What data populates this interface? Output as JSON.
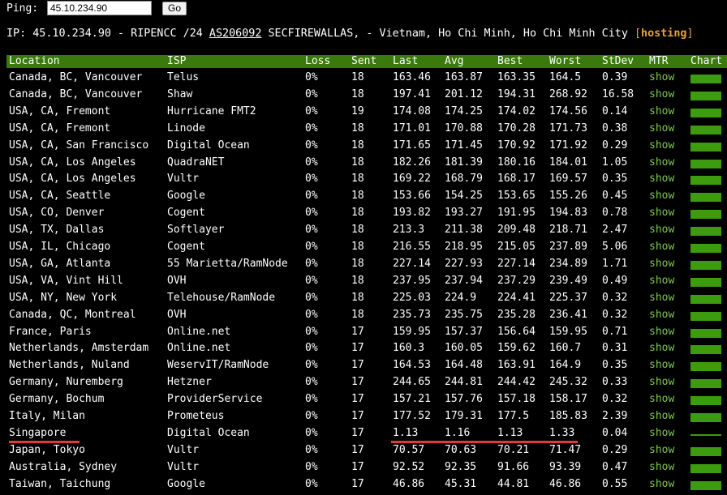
{
  "ping": {
    "label": "Ping:",
    "value": "45.10.234.90",
    "go": "Go"
  },
  "info": {
    "prefix": "IP: 45.10.234.90 - RIPENCC /24 ",
    "asn": "AS206092",
    "rest": " SECFIREWALLAS, - Vietnam, Ho Chi Minh, Ho Chi Minh City ",
    "open": "[",
    "tag": "hosting",
    "close": "]"
  },
  "columns": [
    "Location",
    "ISP",
    "Loss",
    "Sent",
    "Last",
    "Avg",
    "Best",
    "Worst",
    "StDev",
    "MTR",
    "Chart"
  ],
  "colors": {
    "header_bg": "#3a7a0c",
    "link": "#7ec850",
    "bar": "#3d9b10",
    "accent": "#e8a040",
    "underline": "#e03a35"
  },
  "rows": [
    {
      "loc": "Canada, BC, Vancouver",
      "isp": "Telus",
      "loss": "0%",
      "sent": "18",
      "last": "163.46",
      "avg": "163.87",
      "best": "163.35",
      "worst": "164.5",
      "std": "0.39",
      "mtr": "show"
    },
    {
      "loc": "Canada, BC, Vancouver",
      "isp": "Shaw",
      "loss": "0%",
      "sent": "18",
      "last": "197.41",
      "avg": "201.12",
      "best": "194.31",
      "worst": "268.92",
      "std": "16.58",
      "mtr": "show"
    },
    {
      "loc": "USA, CA, Fremont",
      "isp": "Hurricane FMT2",
      "loss": "0%",
      "sent": "19",
      "last": "174.08",
      "avg": "174.25",
      "best": "174.02",
      "worst": "174.56",
      "std": "0.14",
      "mtr": "show"
    },
    {
      "loc": "USA, CA, Fremont",
      "isp": "Linode",
      "loss": "0%",
      "sent": "18",
      "last": "171.01",
      "avg": "170.88",
      "best": "170.28",
      "worst": "171.73",
      "std": "0.38",
      "mtr": "show"
    },
    {
      "loc": "USA, CA, San Francisco",
      "isp": "Digital Ocean",
      "loss": "0%",
      "sent": "18",
      "last": "171.65",
      "avg": "171.45",
      "best": "170.92",
      "worst": "171.92",
      "std": "0.29",
      "mtr": "show"
    },
    {
      "loc": "USA, CA, Los Angeles",
      "isp": "QuadraNET",
      "loss": "0%",
      "sent": "18",
      "last": "182.26",
      "avg": "181.39",
      "best": "180.16",
      "worst": "184.01",
      "std": "1.05",
      "mtr": "show"
    },
    {
      "loc": "USA, CA, Los Angeles",
      "isp": "Vultr",
      "loss": "0%",
      "sent": "18",
      "last": "169.22",
      "avg": "168.79",
      "best": "168.17",
      "worst": "169.57",
      "std": "0.35",
      "mtr": "show"
    },
    {
      "loc": "USA, CA, Seattle",
      "isp": "Google",
      "loss": "0%",
      "sent": "18",
      "last": "153.66",
      "avg": "154.25",
      "best": "153.65",
      "worst": "155.26",
      "std": "0.45",
      "mtr": "show"
    },
    {
      "loc": "USA, CO, Denver",
      "isp": "Cogent",
      "loss": "0%",
      "sent": "18",
      "last": "193.82",
      "avg": "193.27",
      "best": "191.95",
      "worst": "194.83",
      "std": "0.78",
      "mtr": "show"
    },
    {
      "loc": "USA, TX, Dallas",
      "isp": "Softlayer",
      "loss": "0%",
      "sent": "18",
      "last": "213.3",
      "avg": "211.38",
      "best": "209.48",
      "worst": "218.71",
      "std": "2.47",
      "mtr": "show"
    },
    {
      "loc": "USA, IL, Chicago",
      "isp": "Cogent",
      "loss": "0%",
      "sent": "18",
      "last": "216.55",
      "avg": "218.95",
      "best": "215.05",
      "worst": "237.89",
      "std": "5.06",
      "mtr": "show"
    },
    {
      "loc": "USA, GA, Atlanta",
      "isp": "55 Marietta/RamNode",
      "loss": "0%",
      "sent": "18",
      "last": "227.14",
      "avg": "227.93",
      "best": "227.14",
      "worst": "234.89",
      "std": "1.71",
      "mtr": "show"
    },
    {
      "loc": "USA, VA, Vint Hill",
      "isp": "OVH",
      "loss": "0%",
      "sent": "18",
      "last": "237.95",
      "avg": "237.94",
      "best": "237.29",
      "worst": "239.49",
      "std": "0.49",
      "mtr": "show"
    },
    {
      "loc": "USA, NY, New York",
      "isp": "Telehouse/RamNode",
      "loss": "0%",
      "sent": "18",
      "last": "225.03",
      "avg": "224.9",
      "best": "224.41",
      "worst": "225.37",
      "std": "0.32",
      "mtr": "show"
    },
    {
      "loc": "Canada, QC, Montreal",
      "isp": "OVH",
      "loss": "0%",
      "sent": "18",
      "last": "235.73",
      "avg": "235.75",
      "best": "235.28",
      "worst": "236.41",
      "std": "0.32",
      "mtr": "show"
    },
    {
      "loc": "France, Paris",
      "isp": "Online.net",
      "loss": "0%",
      "sent": "17",
      "last": "159.95",
      "avg": "157.37",
      "best": "156.64",
      "worst": "159.95",
      "std": "0.71",
      "mtr": "show"
    },
    {
      "loc": "Netherlands, Amsterdam",
      "isp": "Online.net",
      "loss": "0%",
      "sent": "17",
      "last": "160.3",
      "avg": "160.05",
      "best": "159.62",
      "worst": "160.7",
      "std": "0.31",
      "mtr": "show"
    },
    {
      "loc": "Netherlands, Nuland",
      "isp": "WeservIT/RamNode",
      "loss": "0%",
      "sent": "17",
      "last": "164.53",
      "avg": "164.48",
      "best": "163.91",
      "worst": "164.9",
      "std": "0.35",
      "mtr": "show"
    },
    {
      "loc": "Germany, Nuremberg",
      "isp": "Hetzner",
      "loss": "0%",
      "sent": "17",
      "last": "244.65",
      "avg": "244.81",
      "best": "244.42",
      "worst": "245.32",
      "std": "0.33",
      "mtr": "show"
    },
    {
      "loc": "Germany, Bochum",
      "isp": "ProviderService",
      "loss": "0%",
      "sent": "17",
      "last": "157.21",
      "avg": "157.76",
      "best": "157.18",
      "worst": "158.17",
      "std": "0.32",
      "mtr": "show"
    },
    {
      "loc": "Italy, Milan",
      "isp": "Prometeus",
      "loss": "0%",
      "sent": "17",
      "last": "177.52",
      "avg": "179.31",
      "best": "177.5",
      "worst": "185.83",
      "std": "2.39",
      "mtr": "show"
    },
    {
      "loc": "Singapore",
      "isp": "Digital Ocean",
      "loss": "0%",
      "sent": "17",
      "last": "1.13",
      "avg": "1.16",
      "best": "1.13",
      "worst": "1.33",
      "std": "0.04",
      "mtr": "show"
    },
    {
      "loc": "Japan, Tokyo",
      "isp": "Vultr",
      "loss": "0%",
      "sent": "17",
      "last": "70.57",
      "avg": "70.63",
      "best": "70.21",
      "worst": "71.47",
      "std": "0.29",
      "mtr": "show"
    },
    {
      "loc": "Australia, Sydney",
      "isp": "Vultr",
      "loss": "0%",
      "sent": "17",
      "last": "92.52",
      "avg": "92.35",
      "best": "91.66",
      "worst": "93.39",
      "std": "0.47",
      "mtr": "show"
    },
    {
      "loc": "Taiwan, Taichung",
      "isp": "Google",
      "loss": "0%",
      "sent": "17",
      "last": "46.86",
      "avg": "45.31",
      "best": "44.81",
      "worst": "46.86",
      "std": "0.55",
      "mtr": "show"
    }
  ]
}
